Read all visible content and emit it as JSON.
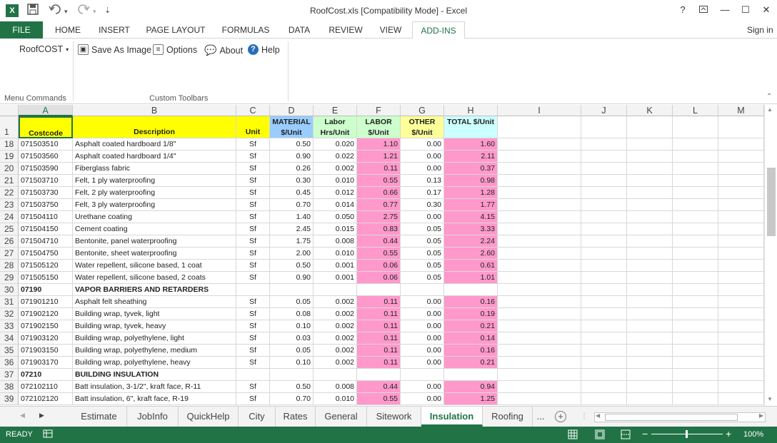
{
  "window": {
    "title": "RoofCost.xls  [Compatibility Mode] - Excel",
    "app_icon": "X",
    "help": "?",
    "restore_icon": "ribbon-display-icon",
    "minimize": "—",
    "maximize": "☐",
    "close": "✕"
  },
  "quick_access": {
    "save_icon": "save-icon",
    "undo_icon": "undo-icon",
    "redo_icon": "redo-icon",
    "customize": "⇣"
  },
  "ribbon_tabs": [
    "FILE",
    "HOME",
    "INSERT",
    "PAGE LAYOUT",
    "FORMULAS",
    "DATA",
    "REVIEW",
    "VIEW",
    "ADD-INS"
  ],
  "active_ribbon_tab": "ADD-INS",
  "sign_in": "Sign in",
  "ribbon": {
    "roofcost_menu": "RoofCOST",
    "save_as_image": "Save As Image",
    "options": "Options",
    "about": "About",
    "help": "Help",
    "group_menu": "Menu Commands",
    "group_toolbars": "Custom Toolbars"
  },
  "columns": [
    "A",
    "B",
    "C",
    "D",
    "E",
    "F",
    "G",
    "H",
    "I",
    "J",
    "K",
    "L",
    "M"
  ],
  "header_row": {
    "row": "1",
    "a": "Costcode",
    "b": "Description",
    "c": "Unit",
    "d": "MATERIAL $/Unit",
    "e": "Labor Hrs/Unit",
    "f": "LABOR $/Unit",
    "g": "OTHER $/Unit",
    "h": "TOTAL $/Unit"
  },
  "rows": [
    {
      "n": "18",
      "code": "071503510",
      "desc": "Asphalt coated hardboard 1/8\"",
      "unit": "Sf",
      "mat": "0.50",
      "hrs": "0.020",
      "lab": "1.10",
      "oth": "0.00",
      "tot": "1.60"
    },
    {
      "n": "19",
      "code": "071503560",
      "desc": "Asphalt coated hardboard 1/4\"",
      "unit": "Sf",
      "mat": "0.90",
      "hrs": "0.022",
      "lab": "1.21",
      "oth": "0.00",
      "tot": "2.11"
    },
    {
      "n": "20",
      "code": "071503590",
      "desc": "Fiberglass fabric",
      "unit": "Sf",
      "mat": "0.26",
      "hrs": "0.002",
      "lab": "0.11",
      "oth": "0.00",
      "tot": "0.37"
    },
    {
      "n": "21",
      "code": "071503710",
      "desc": "Felt, 1 ply waterproofing",
      "unit": "Sf",
      "mat": "0.30",
      "hrs": "0.010",
      "lab": "0.55",
      "oth": "0.13",
      "tot": "0.98"
    },
    {
      "n": "22",
      "code": "071503730",
      "desc": "Felt, 2 ply waterproofing",
      "unit": "Sf",
      "mat": "0.45",
      "hrs": "0.012",
      "lab": "0.66",
      "oth": "0.17",
      "tot": "1.28"
    },
    {
      "n": "23",
      "code": "071503750",
      "desc": "Felt, 3 ply waterproofing",
      "unit": "Sf",
      "mat": "0.70",
      "hrs": "0.014",
      "lab": "0.77",
      "oth": "0.30",
      "tot": "1.77"
    },
    {
      "n": "24",
      "code": "071504110",
      "desc": "Urethane coating",
      "unit": "Sf",
      "mat": "1.40",
      "hrs": "0.050",
      "lab": "2.75",
      "oth": "0.00",
      "tot": "4.15"
    },
    {
      "n": "25",
      "code": "071504150",
      "desc": "Cement coating",
      "unit": "Sf",
      "mat": "2.45",
      "hrs": "0.015",
      "lab": "0.83",
      "oth": "0.05",
      "tot": "3.33"
    },
    {
      "n": "26",
      "code": "071504710",
      "desc": "Bentonite, panel waterproofing",
      "unit": "Sf",
      "mat": "1.75",
      "hrs": "0.008",
      "lab": "0.44",
      "oth": "0.05",
      "tot": "2.24"
    },
    {
      "n": "27",
      "code": "071504750",
      "desc": "Bentonite, sheet waterproofing",
      "unit": "Sf",
      "mat": "2.00",
      "hrs": "0.010",
      "lab": "0.55",
      "oth": "0.05",
      "tot": "2.60"
    },
    {
      "n": "28",
      "code": "071505120",
      "desc": "Water repellent, silicone based, 1 coat",
      "unit": "Sf",
      "mat": "0.50",
      "hrs": "0.001",
      "lab": "0.06",
      "oth": "0.05",
      "tot": "0.61"
    },
    {
      "n": "29",
      "code": "071505150",
      "desc": "Water repellent, silicone based, 2 coats",
      "unit": "Sf",
      "mat": "0.90",
      "hrs": "0.001",
      "lab": "0.06",
      "oth": "0.05",
      "tot": "1.01"
    },
    {
      "n": "30",
      "code": "07190",
      "desc": "VAPOR BARRIERS AND RETARDERS",
      "unit": "",
      "mat": "",
      "hrs": "",
      "lab": "",
      "oth": "",
      "tot": "",
      "section": true
    },
    {
      "n": "31",
      "code": "071901210",
      "desc": "Asphalt felt sheathing",
      "unit": "Sf",
      "mat": "0.05",
      "hrs": "0.002",
      "lab": "0.11",
      "oth": "0.00",
      "tot": "0.16"
    },
    {
      "n": "32",
      "code": "071902120",
      "desc": "Building wrap, tyvek, light",
      "unit": "Sf",
      "mat": "0.08",
      "hrs": "0.002",
      "lab": "0.11",
      "oth": "0.00",
      "tot": "0.19"
    },
    {
      "n": "33",
      "code": "071902150",
      "desc": "Building wrap, tyvek, heavy",
      "unit": "Sf",
      "mat": "0.10",
      "hrs": "0.002",
      "lab": "0.11",
      "oth": "0.00",
      "tot": "0.21"
    },
    {
      "n": "34",
      "code": "071903120",
      "desc": "Building wrap, polyethylene, light",
      "unit": "Sf",
      "mat": "0.03",
      "hrs": "0.002",
      "lab": "0.11",
      "oth": "0.00",
      "tot": "0.14"
    },
    {
      "n": "35",
      "code": "071903150",
      "desc": "Building wrap, polyethylene, medium",
      "unit": "Sf",
      "mat": "0.05",
      "hrs": "0.002",
      "lab": "0.11",
      "oth": "0.00",
      "tot": "0.16"
    },
    {
      "n": "36",
      "code": "071903170",
      "desc": "Building wrap, polyethylene, heavy",
      "unit": "Sf",
      "mat": "0.10",
      "hrs": "0.002",
      "lab": "0.11",
      "oth": "0.00",
      "tot": "0.21"
    },
    {
      "n": "37",
      "code": "07210",
      "desc": "BUILDING INSULATION",
      "unit": "",
      "mat": "",
      "hrs": "",
      "lab": "",
      "oth": "",
      "tot": "",
      "section": true
    },
    {
      "n": "38",
      "code": "072102110",
      "desc": "Batt insulation, 3-1/2\", kraft face, R-11",
      "unit": "Sf",
      "mat": "0.50",
      "hrs": "0.008",
      "lab": "0.44",
      "oth": "0.00",
      "tot": "0.94"
    },
    {
      "n": "39",
      "code": "072102120",
      "desc": "Batt insulation, 6\", kraft face, R-19",
      "unit": "Sf",
      "mat": "0.70",
      "hrs": "0.010",
      "lab": "0.55",
      "oth": "0.00",
      "tot": "1.25"
    }
  ],
  "sheet_tabs": [
    "Estimate",
    "JobInfo",
    "QuickHelp",
    "City",
    "Rates",
    "General",
    "Sitework",
    "Insulation",
    "Roofing"
  ],
  "active_sheet": "Insulation",
  "sheet_more": "...",
  "status": {
    "ready": "READY",
    "zoom": "100%"
  },
  "colors": {
    "excel_green": "#217346",
    "yellow": "#ffff00",
    "blue": "#99ccff",
    "green": "#ccffcc",
    "pink": "#ff99cc",
    "light_yellow": "#ffff99",
    "cyan": "#ccffff"
  }
}
